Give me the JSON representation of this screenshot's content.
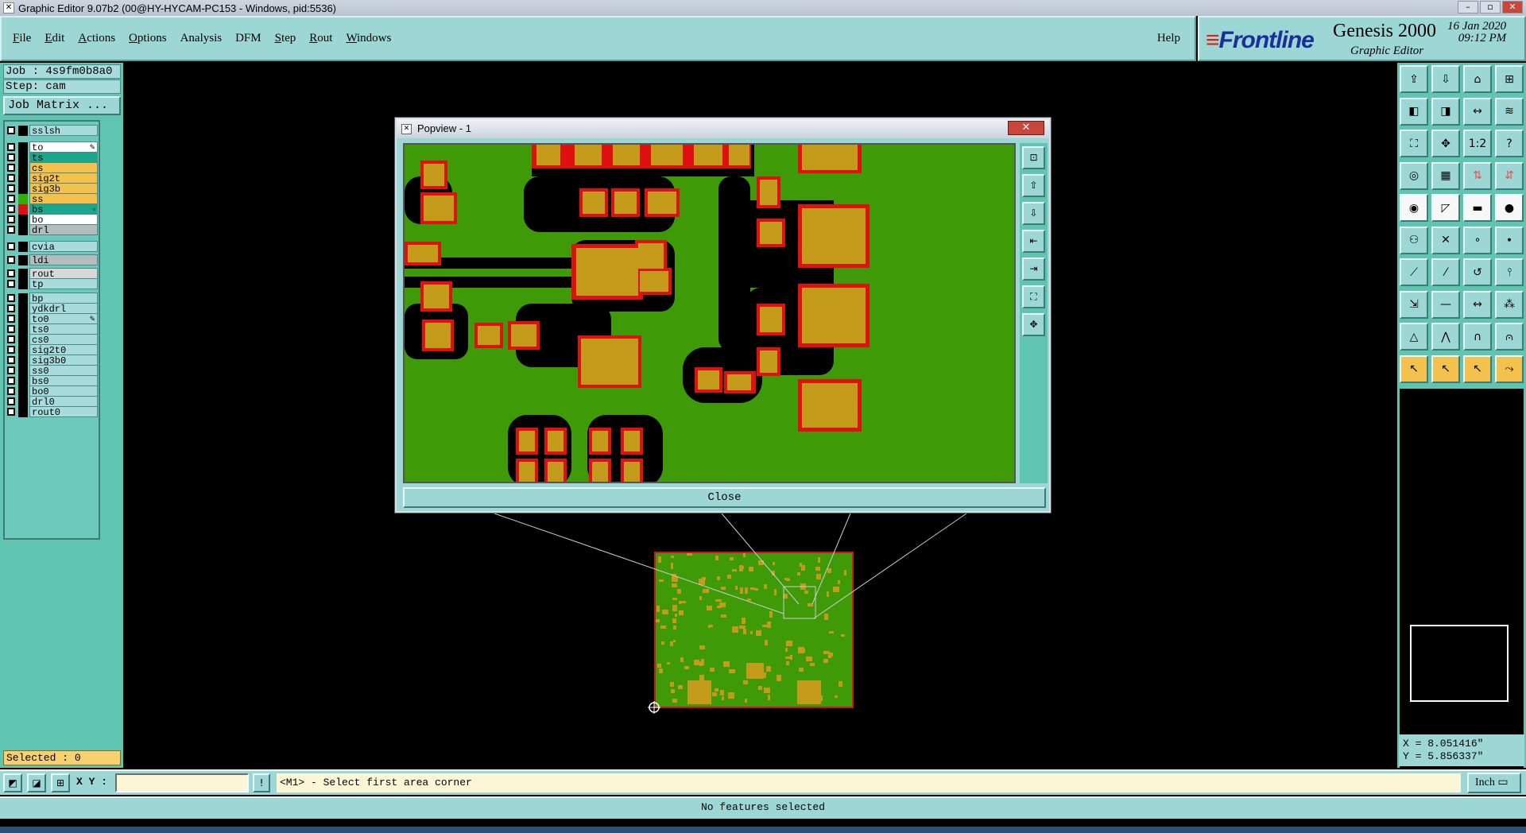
{
  "window": {
    "title": "Graphic Editor 9.07b2 (00@HY-HYCAM-PC153 - Windows, pid:5536)"
  },
  "menu": [
    {
      "label": "File",
      "u": "F",
      "rest": "ile"
    },
    {
      "label": "Edit",
      "u": "E",
      "rest": "dit"
    },
    {
      "label": "Actions",
      "u": "A",
      "rest": "ctions"
    },
    {
      "label": "Options",
      "u": "O",
      "rest": "ptions"
    },
    {
      "label": "Analysis",
      "u": "",
      "rest": "Analysis"
    },
    {
      "label": "DFM",
      "u": "",
      "rest": "DFM"
    },
    {
      "label": "Step",
      "u": "S",
      "rest": "tep"
    },
    {
      "label": "Rout",
      "u": "R",
      "rest": "out"
    },
    {
      "label": "Windows",
      "u": "W",
      "rest": "indows"
    }
  ],
  "help_label": "Help",
  "brand": {
    "logo": "Frontline",
    "product": "Genesis 2000",
    "subtitle": "Graphic Editor",
    "date": "16 Jan 2020",
    "time": "09:12 PM"
  },
  "job": {
    "job_label": "Job : 4s9fm0b8a0",
    "step_label": "Step: cam",
    "matrix_button": "Job Matrix ..."
  },
  "layers": [
    {
      "name": "sslsh",
      "bg": "#a8dcdc",
      "sw": "#000"
    },
    {
      "name": "to",
      "bg": "#ffffff",
      "sw": "#000",
      "mark": "✎"
    },
    {
      "name": "ts",
      "bg": "#1aa68a",
      "sw": "#000"
    },
    {
      "name": "cs",
      "bg": "#f4c24c",
      "sw": "#000"
    },
    {
      "name": "sig2t",
      "bg": "#f4c24c",
      "sw": "#000"
    },
    {
      "name": "sig3b",
      "bg": "#f4c24c",
      "sw": "#000"
    },
    {
      "name": "ss",
      "bg": "#f4c24c",
      "sw": "#2db000"
    },
    {
      "name": "bs",
      "bg": "#1aa68a",
      "sw": "#e01010",
      "mark": "▫"
    },
    {
      "name": "bo",
      "bg": "#ffffff",
      "sw": "#000"
    },
    {
      "name": "drl",
      "bg": "#b5bcbc",
      "sw": "#000"
    },
    {
      "name": "cvia",
      "bg": "#a8dcdc",
      "sw": "#000"
    },
    {
      "name": "ldi",
      "bg": "#b5bcbc",
      "sw": "#000"
    },
    {
      "name": "rout",
      "bg": "#d8d8d8",
      "sw": "#000"
    },
    {
      "name": "tp",
      "bg": "#a8dcdc",
      "sw": "#000"
    },
    {
      "name": "bp",
      "bg": "#a8dcdc",
      "sw": "#000"
    },
    {
      "name": "ydkdrl",
      "bg": "#a8dcdc",
      "sw": "#000"
    },
    {
      "name": "to0",
      "bg": "#a8dcdc",
      "sw": "#000",
      "mark": "✎"
    },
    {
      "name": "ts0",
      "bg": "#a8dcdc",
      "sw": "#000"
    },
    {
      "name": "cs0",
      "bg": "#a8dcdc",
      "sw": "#000"
    },
    {
      "name": "sig2t0",
      "bg": "#a8dcdc",
      "sw": "#000"
    },
    {
      "name": "sig3b0",
      "bg": "#a8dcdc",
      "sw": "#000"
    },
    {
      "name": "ss0",
      "bg": "#a8dcdc",
      "sw": "#000"
    },
    {
      "name": "bs0",
      "bg": "#a8dcdc",
      "sw": "#000"
    },
    {
      "name": "bo0",
      "bg": "#a8dcdc",
      "sw": "#000"
    },
    {
      "name": "drl0",
      "bg": "#a8dcdc",
      "sw": "#000"
    },
    {
      "name": "rout0",
      "bg": "#a8dcdc",
      "sw": "#000"
    }
  ],
  "selected_label": "Selected : 0",
  "popview": {
    "title": "Popview - 1",
    "close_button": "Close"
  },
  "coords": {
    "x": "X = 8.051416\"",
    "y": "Y = 5.856337\""
  },
  "command": {
    "xy_label": "X Y :",
    "xy_value": "",
    "prompt": "<M1> - Select first area corner",
    "unit": "Inch"
  },
  "status": "No features selected",
  "colors": {
    "panel": "#9cd7d6",
    "canvas": "#000000",
    "copper": "#c39a1a",
    "mask": "#3f9a08",
    "outline": "#c8161a"
  }
}
